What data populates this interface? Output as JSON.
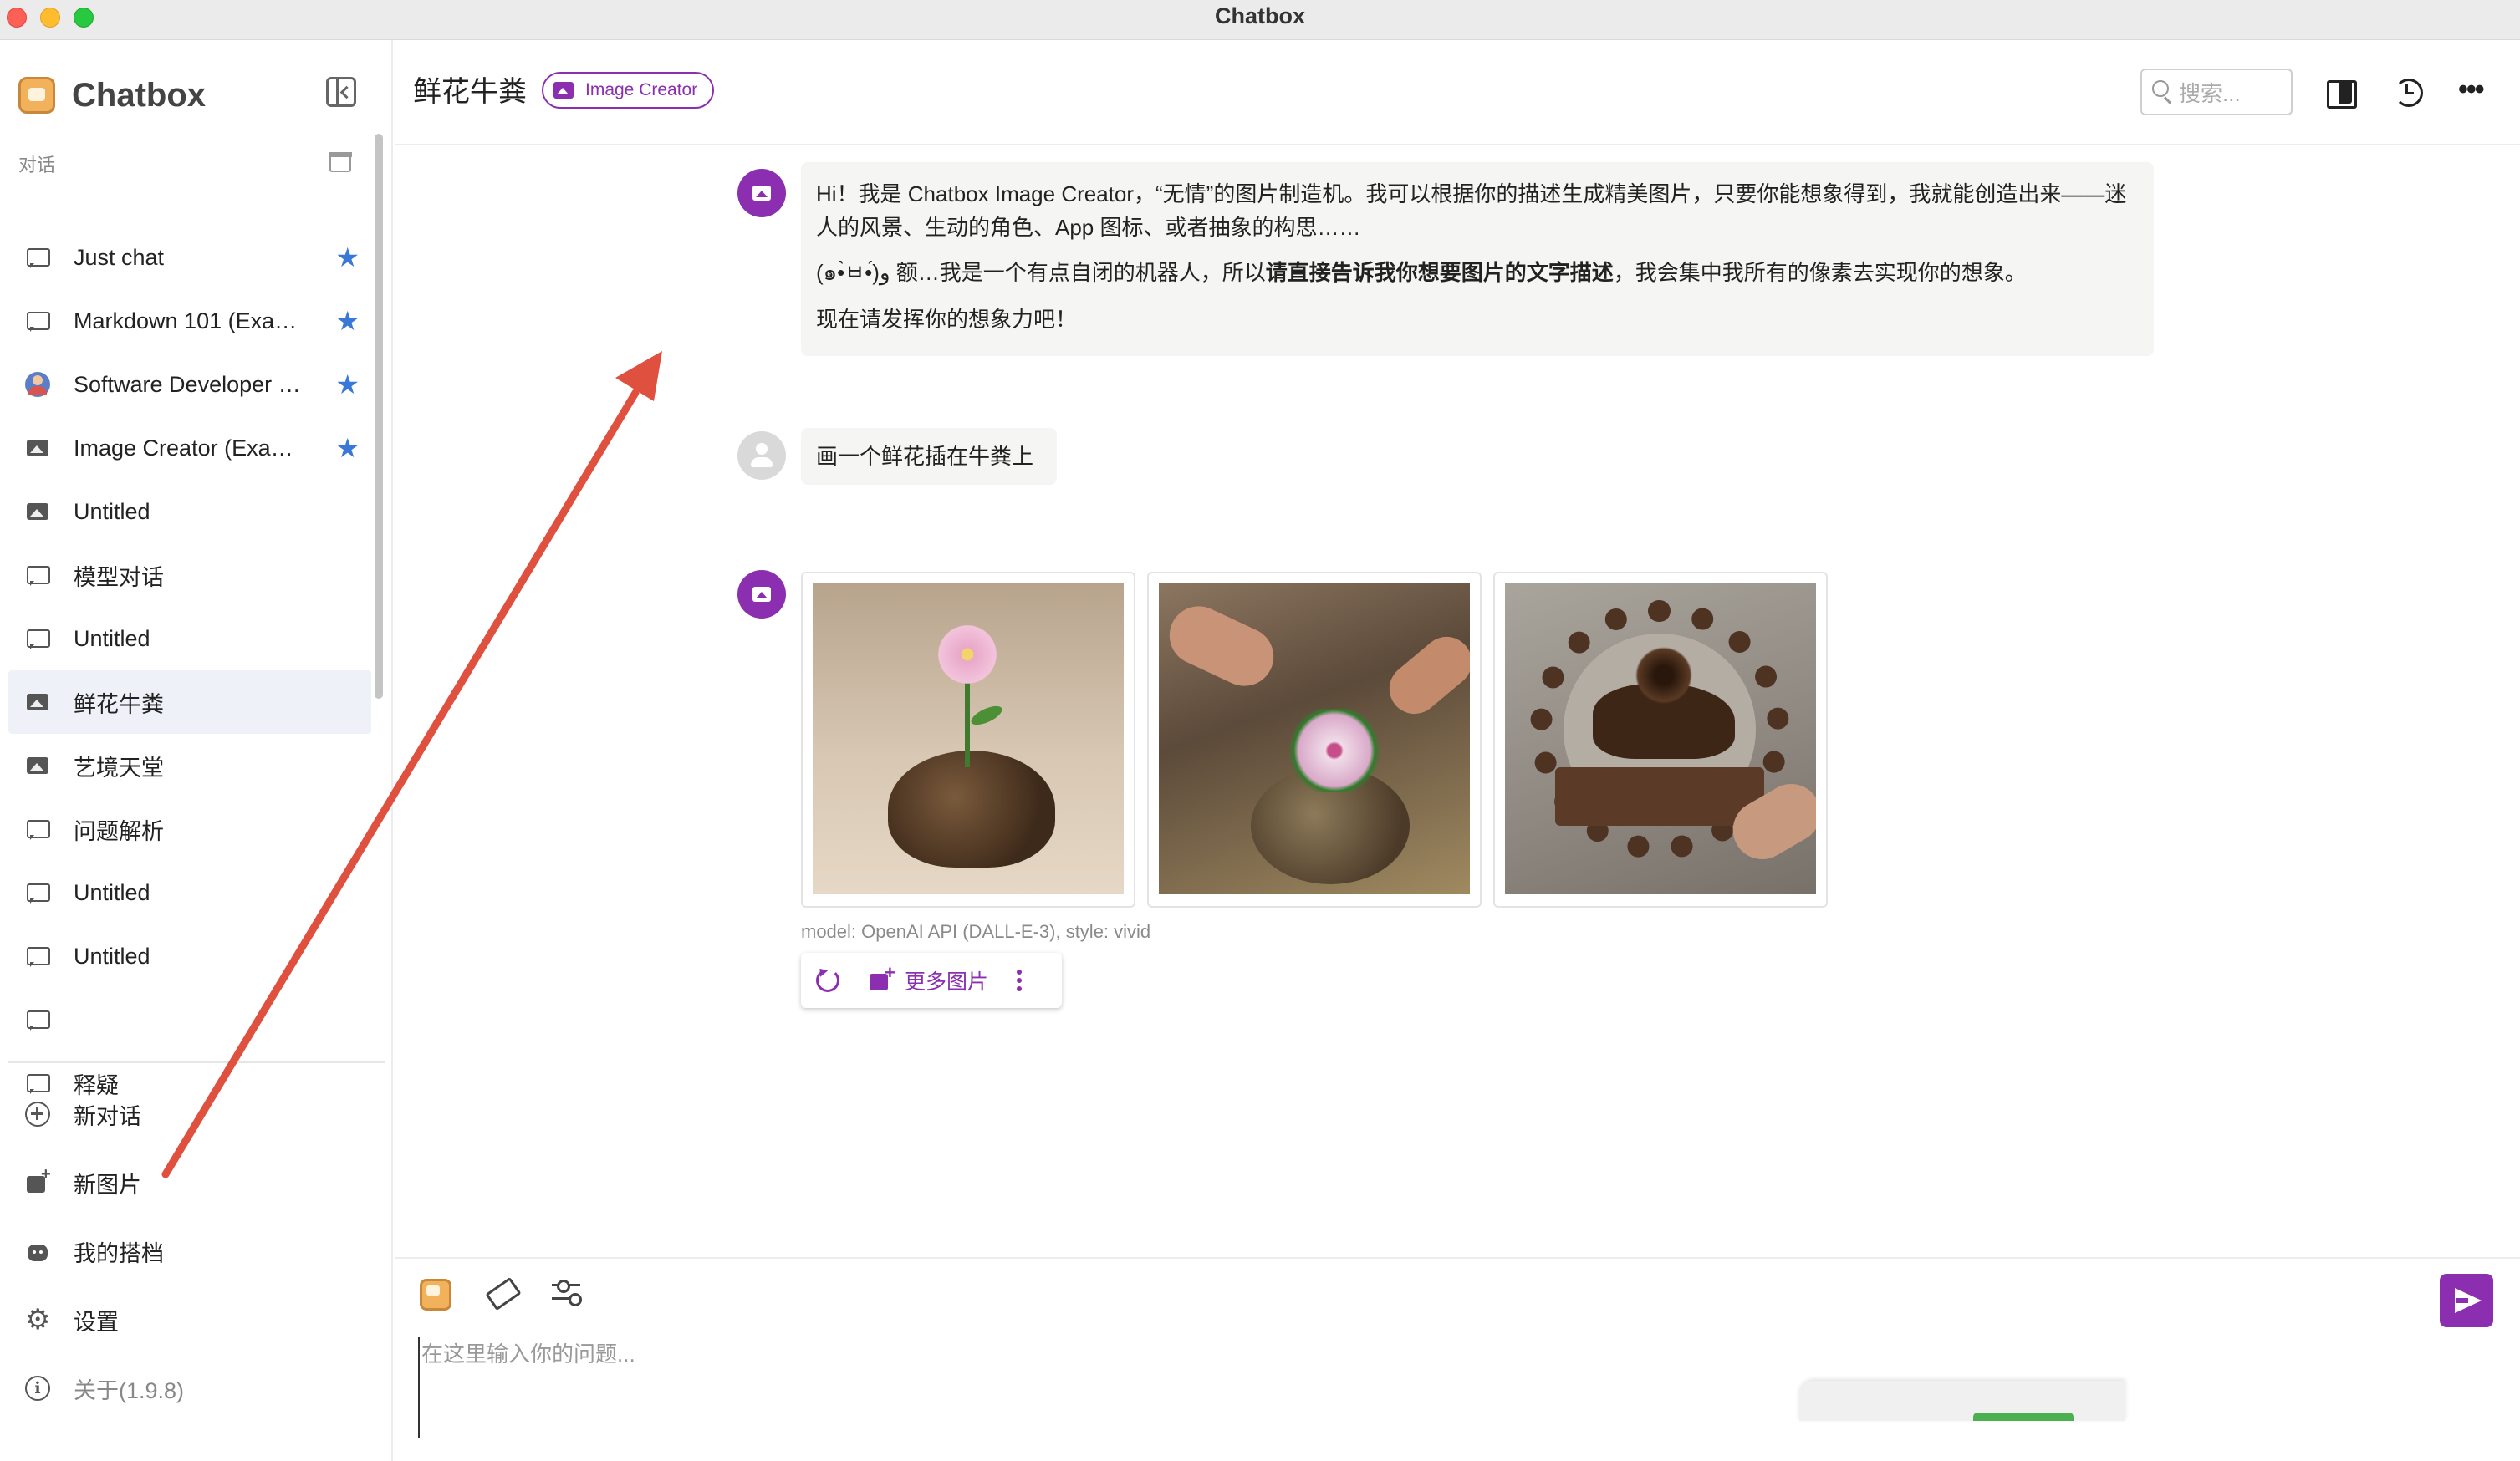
{
  "window": {
    "title": "Chatbox"
  },
  "sidebar": {
    "brand": "Chatbox",
    "section_label": "对话",
    "conversations": [
      {
        "label": "Just chat",
        "icon": "chat-bubble-icon",
        "starred": true
      },
      {
        "label": "Markdown 101 (Exa…",
        "icon": "chat-bubble-icon",
        "starred": true
      },
      {
        "label": "Software Developer …",
        "icon": "developer-avatar-icon",
        "starred": true
      },
      {
        "label": "Image Creator (Exa…",
        "icon": "image-icon",
        "starred": true
      },
      {
        "label": "Untitled",
        "icon": "image-icon",
        "starred": false
      },
      {
        "label": "模型对话",
        "icon": "chat-bubble-icon",
        "starred": false
      },
      {
        "label": "Untitled",
        "icon": "chat-bubble-icon",
        "starred": false
      },
      {
        "label": "鲜花牛粪",
        "icon": "image-icon",
        "starred": false,
        "active": true
      },
      {
        "label": "艺境天堂",
        "icon": "image-icon",
        "starred": false
      },
      {
        "label": "问题解析",
        "icon": "chat-bubble-icon",
        "starred": false
      },
      {
        "label": "Untitled",
        "icon": "chat-bubble-icon",
        "starred": false
      },
      {
        "label": "Untitled",
        "icon": "chat-bubble-icon",
        "starred": false
      },
      {
        "label": "",
        "icon": "chat-bubble-icon",
        "starred": false
      },
      {
        "label": "释疑",
        "icon": "chat-bubble-icon",
        "starred": false
      }
    ],
    "star_glyph": "★",
    "actions": {
      "new_chat": "新对话",
      "new_image": "新图片",
      "my_copilots": "我的搭档",
      "settings": "设置",
      "about": "关于(1.9.8)"
    },
    "gear_glyph": "⚙",
    "info_glyph": "i"
  },
  "header": {
    "chat_title": "鲜花牛粪",
    "badge": "Image Creator",
    "search_placeholder": "搜索...",
    "more_glyph": "•••"
  },
  "messages": {
    "assistant_intro": {
      "line1": "Hi！我是 Chatbox Image Creator，“无情”的图片制造机。我可以根据你的描述生成精美图片，只要你能想象得到，我就能创造出来——迷人的风景、生动的角色、App 图标、或者抽象的构思……",
      "line2_prefix": "(๑•̀ㅂ•́)و 额…我是一个有点自闭的机器人，所以",
      "line2_bold": "请直接告诉我你想要图片的文字描述",
      "line2_suffix": "，我会集中我所有的像素去实现你的想象。",
      "line3": "现在请发挥你的想象力吧！"
    },
    "user_prompt": "画一个鲜花插在牛粪上",
    "image_caption": "model: OpenAI API (DALL-E-3), style: vivid",
    "more_images_label": "更多图片"
  },
  "composer": {
    "placeholder": "在这里输入你的问题..."
  },
  "colors": {
    "accent": "#8b2fb0",
    "star": "#3a78d8",
    "annotation_arrow": "#e0503f",
    "active_row": "#eef1f7"
  }
}
